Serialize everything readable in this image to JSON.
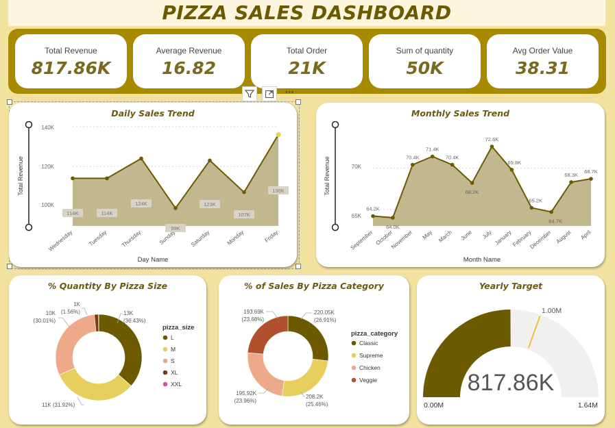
{
  "title": "PIZZA SALES DASHBOARD",
  "kpis": [
    {
      "label": "Total Revenue",
      "value": "817.86K"
    },
    {
      "label": "Average Revenue",
      "value": "16.82"
    },
    {
      "label": "Total Order",
      "value": "21K"
    },
    {
      "label": "Sum of quantity",
      "value": "50K"
    },
    {
      "label": "Avg Order Value",
      "value": "38.31"
    }
  ],
  "toolbar": {
    "filter_icon": "filter-icon",
    "focus_icon": "focus-mode-icon",
    "more_label": "⋯"
  },
  "colors": {
    "gold_dark": "#6b5a00",
    "gold": "#a88a00",
    "area_fill": "#c2b78f",
    "classic": "#6b5a00",
    "supreme": "#e6cf5c",
    "chicken": "#eea98b",
    "veggie": "#b0502c",
    "xxl": "#d94fa6",
    "gauge_track": "#f2f0ef"
  },
  "daily": {
    "title": "Daily Sales Trend",
    "xlabel": "Day Name",
    "ylabel": "Total Revenue",
    "ticks": [
      "140K",
      "120K",
      "100K"
    ]
  },
  "monthly": {
    "title": "Monthly Sales Trend",
    "xlabel": "Month Name",
    "ylabel": "Total Revenue",
    "ticks": [
      "70K",
      "65K"
    ]
  },
  "size_donut": {
    "title": "% Quantity By Pizza Size",
    "legend_title": "pizza_size"
  },
  "category_donut": {
    "title": "% of Sales By Pizza Category",
    "legend_title": "pizza_category"
  },
  "gauge": {
    "title": "Yearly Target",
    "value_label": "817.86K",
    "target_label": "1.00M",
    "min_label": "0.00M",
    "max_label": "1.64M"
  },
  "chart_data": [
    {
      "type": "area",
      "title": "Daily Sales Trend",
      "xlabel": "Day Name",
      "ylabel": "Total Revenue",
      "ylim": [
        90000,
        140000
      ],
      "categories": [
        "Wednesday",
        "Tuesday",
        "Thursday",
        "Sunday",
        "Saturday",
        "Monday",
        "Friday"
      ],
      "values": [
        114000,
        114000,
        124000,
        99000,
        123000,
        107000,
        136000
      ],
      "labels": [
        "114K",
        "114K",
        "124K",
        "99K",
        "123K",
        "107K",
        "136K"
      ]
    },
    {
      "type": "area",
      "title": "Monthly Sales Trend",
      "xlabel": "Month Name",
      "ylabel": "Total Revenue",
      "ylim": [
        63000,
        75000
      ],
      "categories": [
        "September",
        "October",
        "November",
        "May",
        "March",
        "June",
        "July",
        "January",
        "February",
        "December",
        "August",
        "April"
      ],
      "values": [
        64200,
        64000,
        70400,
        71400,
        70400,
        68200,
        72600,
        69800,
        65200,
        64700,
        68300,
        68700
      ],
      "labels": [
        "64.2K",
        "64.0K",
        "70.4K",
        "71.4K",
        "70.4K",
        "68.2K",
        "72.6K",
        "69.8K",
        "65.2K",
        "64.7K",
        "68.3K",
        "68.7K"
      ]
    },
    {
      "type": "pie",
      "title": "% Quantity By Pizza Size",
      "categories": [
        "L",
        "M",
        "S",
        "XL",
        "XXL"
      ],
      "values": [
        36.43,
        31.92,
        30.01,
        1.56,
        0.08
      ],
      "labels": [
        "13K\n(36.43%)",
        "11K (31.92%)",
        "10K\n(30.01%)",
        "1K\n(1.56%)",
        ""
      ],
      "colors": [
        "#6b5a00",
        "#e6cf5c",
        "#eea98b",
        "#7a3a12",
        "#d94fa6"
      ]
    },
    {
      "type": "pie",
      "title": "% of Sales By Pizza Category",
      "categories": [
        "Classic",
        "Supreme",
        "Chicken",
        "Veggie"
      ],
      "values": [
        26.91,
        25.46,
        23.96,
        23.68
      ],
      "labels": [
        "220.05K\n(26.91%)",
        "208.2K\n(25.46%)",
        "195.92K\n(23.96%)",
        "193.69K\n(23.68%)"
      ],
      "colors": [
        "#6b5a00",
        "#e6cf5c",
        "#eea98b",
        "#b0502c"
      ]
    },
    {
      "type": "gauge",
      "title": "Yearly Target",
      "value": 817860,
      "target": 1000000,
      "min": 0,
      "max": 1640000
    }
  ]
}
